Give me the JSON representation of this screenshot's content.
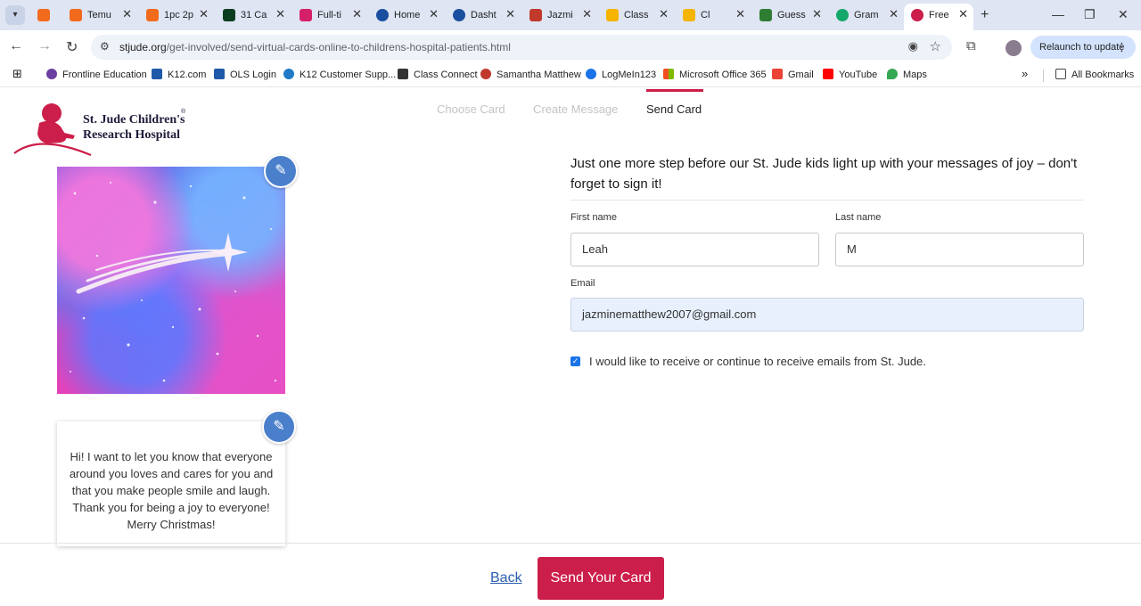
{
  "browser": {
    "tabs": [
      {
        "label": "",
        "color": "#f26b1d"
      },
      {
        "label": "Temu",
        "color": "#f26b1d"
      },
      {
        "label": "1pc 2p",
        "color": "#f26b1d"
      },
      {
        "label": "31 Ca",
        "color": "#0b3d1f"
      },
      {
        "label": "Full-ti",
        "color": "#d61f69"
      },
      {
        "label": "Home",
        "color": "#1a4fa0"
      },
      {
        "label": "Dasht",
        "color": "#1a4fa0"
      },
      {
        "label": "Jazmi",
        "color": "#c0392b"
      },
      {
        "label": "Class",
        "color": "#f4b400"
      },
      {
        "label": "Cl",
        "color": "#f4b400"
      },
      {
        "label": "Guess",
        "color": "#2e7d32"
      },
      {
        "label": "Gram",
        "color": "#15a86b"
      },
      {
        "label": "Free",
        "color": "#cc1e4a"
      }
    ],
    "new_tab": "+",
    "url_domain": "stjude.org",
    "url_path": "/get-involved/send-virtual-cards-online-to-childrens-hospital-patients.html",
    "relaunch_label": "Relaunch to update",
    "bookmarks": [
      {
        "label": "Frontline Education",
        "color": "#6b3fa0"
      },
      {
        "label": "K12.com",
        "color": "#1f5aa8"
      },
      {
        "label": "OLS Login",
        "color": "#1f5aa8"
      },
      {
        "label": "K12 Customer Supp...",
        "color": "#1f7ac8"
      },
      {
        "label": "Class Connect",
        "color": "#333333"
      },
      {
        "label": "Samantha Matthew",
        "color": "#c0392b"
      },
      {
        "label": "LogMeIn123",
        "color": "#1a73e8"
      },
      {
        "label": "Microsoft Office 365",
        "color": "#f25022"
      },
      {
        "label": "Gmail",
        "color": "#ea4335"
      },
      {
        "label": "YouTube",
        "color": "#ff0000"
      },
      {
        "label": "Maps",
        "color": "#34a853"
      }
    ],
    "more_bookmarks": "»",
    "all_bookmarks": "All Bookmarks"
  },
  "page": {
    "logo_line1": "St. Jude Children's",
    "logo_line2": "Research Hospital",
    "logo_reg": "®",
    "steps": [
      {
        "label": "Choose Card",
        "active": false
      },
      {
        "label": "Create Message",
        "active": false
      },
      {
        "label": "Send Card",
        "active": true
      }
    ],
    "intro": "Just one more step before our St. Jude kids light up with your messages of joy – don't forget to sign it!",
    "first_name_label": "First name",
    "first_name_value": "Leah",
    "last_name_label": "Last name",
    "last_name_value": "M",
    "email_label": "Email",
    "email_value": "jazminematthew2007@gmail.com",
    "optin_checked": true,
    "optin_label": "I would like to receive or continue to receive emails from St. Jude.",
    "message": "Hi!  I want to let you know that everyone around you loves and cares for you and that you make people smile and laugh.  Thank you for being a joy to everyone!  Merry Christmas!",
    "back_label": "Back",
    "send_label": "Send Your Card",
    "accent_color": "#cc1e4a",
    "edit_color": "#4a7fcb"
  }
}
